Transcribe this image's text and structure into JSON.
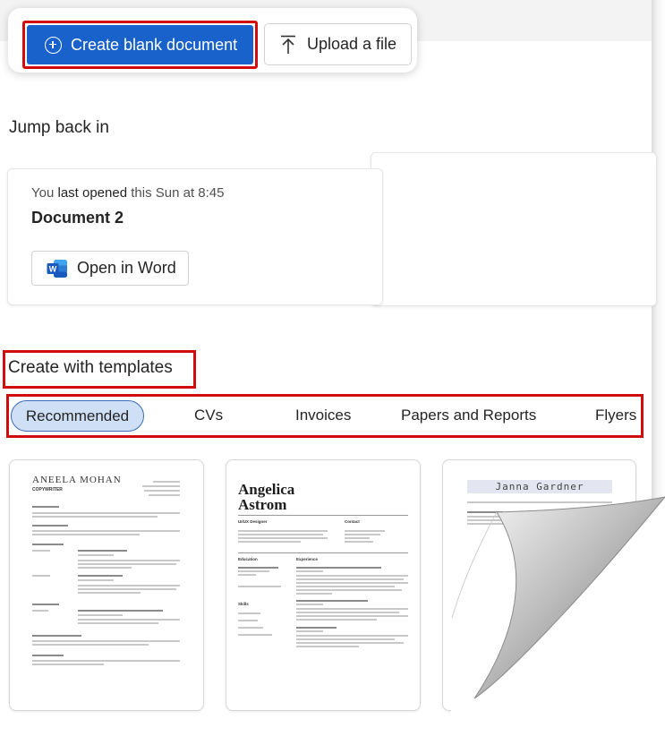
{
  "actions": {
    "create_blank_label": "Create blank document",
    "upload_label": "Upload a file"
  },
  "jump_back": {
    "heading": "Jump back in",
    "last_opened_prefix": "You ",
    "last_opened_bold": "last opened",
    "last_opened_suffix": " this Sun at 8:45",
    "doc_name": "Document 2",
    "open_label": "Open in Word"
  },
  "templates": {
    "heading": "Create with templates",
    "tabs": [
      {
        "label": "Recommended",
        "selected": true
      },
      {
        "label": "CVs",
        "selected": false
      },
      {
        "label": "Invoices",
        "selected": false
      },
      {
        "label": "Papers and Reports",
        "selected": false
      },
      {
        "label": "Flyers",
        "selected": false
      }
    ],
    "cards": [
      {
        "name": "ANEELA MOHAN",
        "subtitle": "COPYWRITER"
      },
      {
        "name_line1": "Angelica",
        "name_line2": "Astrom",
        "role": "UI/UX Designer",
        "contact": "Contact",
        "education": "Education",
        "experience": "Experience",
        "skills": "Skills"
      },
      {
        "name": "Janna Gardner"
      }
    ]
  },
  "colors": {
    "primary": "#1a62cb",
    "highlight_border": "#d10c0c",
    "tab_selected_bg": "#cfe0f6",
    "word_blue": "#185abd"
  },
  "icons": {
    "create": "plus-circle-icon",
    "upload": "upload-arrow-icon",
    "word": "word-app-icon"
  }
}
